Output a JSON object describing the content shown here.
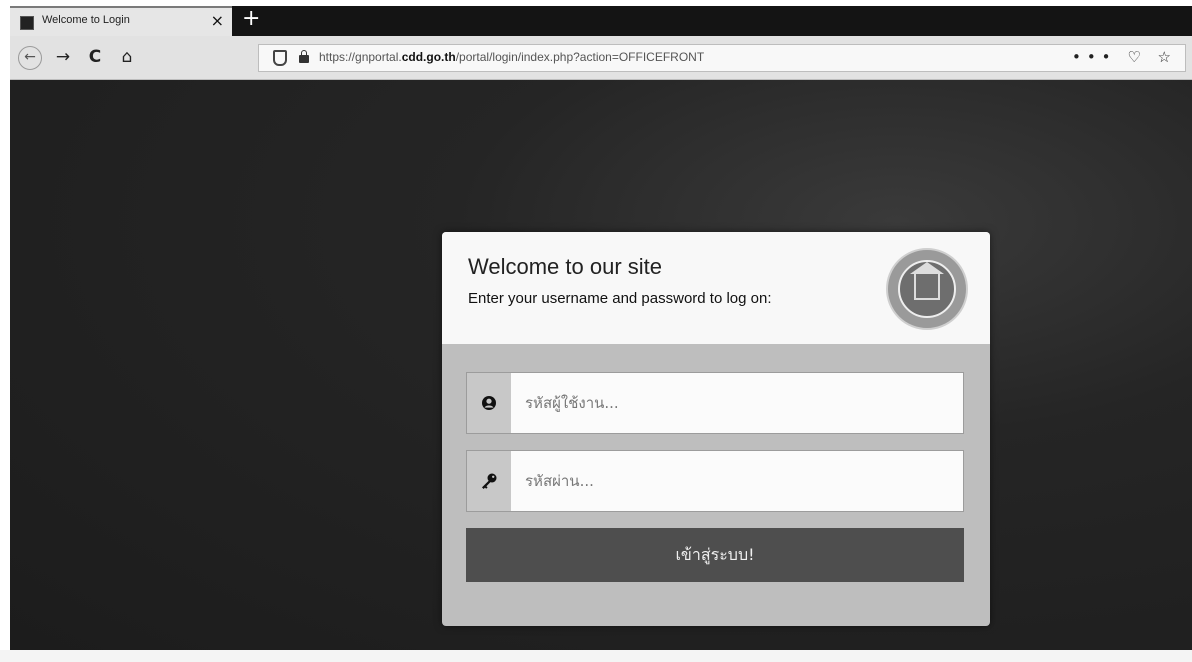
{
  "browser": {
    "tab_title": "Welcome to Login",
    "tab_close": "×",
    "new_tab": "+",
    "nav": {
      "back": "←",
      "forward": "→",
      "reload": "C",
      "home": "⌂"
    },
    "url_prefix": "https://gnportal.",
    "url_domain": "cdd.go.th",
    "url_suffix": "/portal/login/index.php?action=OFFICEFRONT",
    "url_actions": {
      "more": "•••",
      "pocket": "♡",
      "bookmark": "☆"
    }
  },
  "login": {
    "title": "Welcome to our site",
    "subtitle": "Enter your username and password to log on:",
    "username_placeholder": "รหัสผู้ใช้งาน...",
    "password_placeholder": "รหัสผ่าน...",
    "submit_label": "เข้าสู่ระบบ!"
  },
  "colors": {
    "page_background": "#1c1c1c",
    "card_header": "#f8f8f8",
    "card_body": "#bebebe",
    "button": "#4e4e4e"
  },
  "icons": {
    "user_field": "user-icon",
    "password_field": "key-icon",
    "logo": "department-seal-logo"
  }
}
